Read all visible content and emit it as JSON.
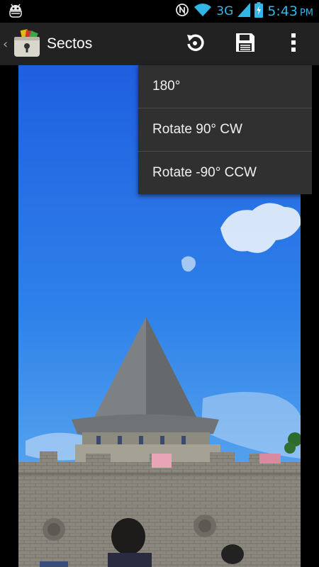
{
  "status_bar": {
    "network": "3G",
    "time": "5:43",
    "ampm": "PM",
    "icons": [
      "android-debug-icon",
      "nfc-icon",
      "wifi-icon",
      "signal-icon",
      "battery-charging-icon"
    ],
    "accent_color": "#33b5e5"
  },
  "action_bar": {
    "title": "Sectos",
    "actions": [
      "rotate-icon",
      "save-icon",
      "overflow-menu-icon"
    ]
  },
  "menu": {
    "items": [
      {
        "label": "180°"
      },
      {
        "label": "Rotate 90° CW"
      },
      {
        "label": "Rotate -90° CCW"
      }
    ]
  },
  "photo": {
    "subject": "castle-tower-photo"
  }
}
